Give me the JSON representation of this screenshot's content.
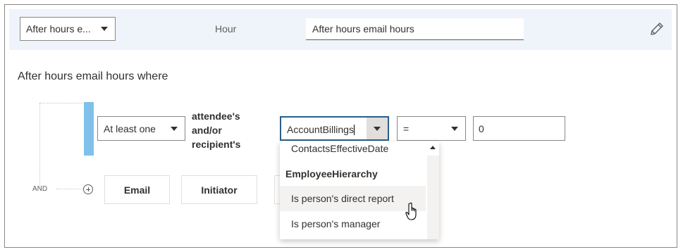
{
  "header": {
    "metric_dropdown_value": "After hours e...",
    "hour_label": "Hour",
    "metric_name_value": "After hours email hours",
    "edit_icon": "pencil-icon"
  },
  "filter": {
    "title": "After hours email hours where",
    "join_label": "AND",
    "quantifier_value": "At least one",
    "subject_label": "attendee's and/or recipient's",
    "attribute_value": "AccountBillings",
    "operator_value": "=",
    "value": "0"
  },
  "chips": [
    {
      "label": "Email"
    },
    {
      "label": "Initiator"
    }
  ],
  "dropdown_list": {
    "items": [
      {
        "label": "ContactsEffectiveDate",
        "type": "option"
      },
      {
        "label": "EmployeeHierarchy",
        "type": "group-header"
      },
      {
        "label": "Is person's direct report",
        "type": "option",
        "hovered": true
      },
      {
        "label": "Is person's manager",
        "type": "option"
      }
    ]
  },
  "colors": {
    "accent_bar": "#7fc1ea",
    "focus_border": "#2b5d8a",
    "header_band": "#eef4fa"
  }
}
